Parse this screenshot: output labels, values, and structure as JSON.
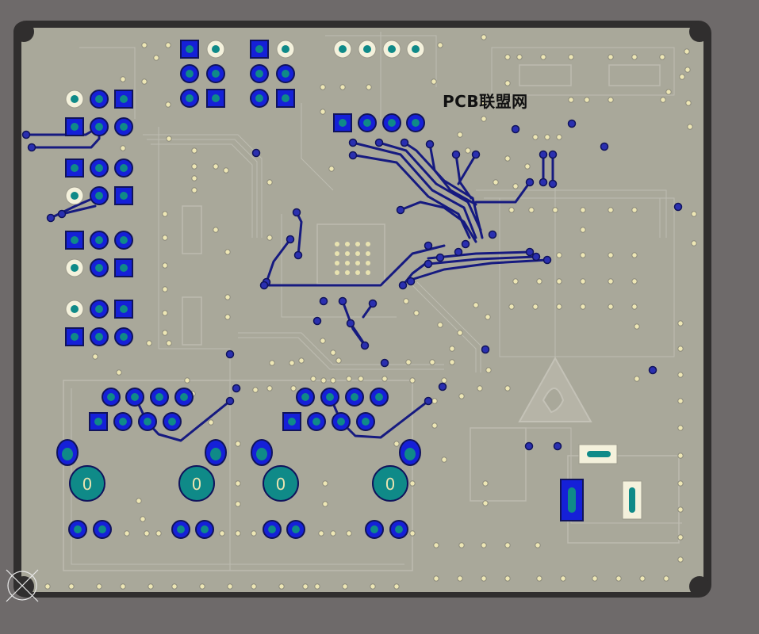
{
  "board": {
    "watermark": "PCB联盟网",
    "colors": {
      "background": "#6e6a6a",
      "board_fill": "#a9a89a",
      "board_edge": "#2f2d2d",
      "trace_dark": "#161a80",
      "pad_blue": "#1520d8",
      "pad_teal": "#0f8a88",
      "via_yellow": "#e9e3b0",
      "trace_ghost": "#c3c2b7"
    },
    "icons": [
      "origin-marker-icon",
      "esd-warning-icon"
    ],
    "pot_label": "0"
  }
}
